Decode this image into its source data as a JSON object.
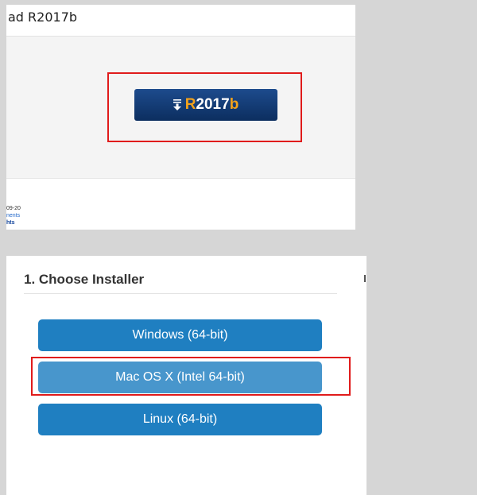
{
  "download_page": {
    "title": "ad R2017b",
    "download_button": {
      "icon": "download-arrow-icon",
      "release_prefix": "R",
      "release_year": "2017",
      "release_suffix": "b"
    },
    "footer": {
      "line1": "09-20",
      "line2": "nents",
      "line3": "hts"
    }
  },
  "installer": {
    "heading": "1. Choose Installer",
    "buttons": [
      {
        "label": "Windows (64-bit)"
      },
      {
        "label": "Mac OS X (Intel 64-bit)",
        "selected": true
      },
      {
        "label": "Linux (64-bit)"
      }
    ]
  },
  "colors": {
    "highlight_box": "#e01b1b",
    "download_button": "#0c2e5f",
    "release_accent": "#f3a21b",
    "installer_button": "#1f7fc1",
    "installer_button_selected": "#4896cc"
  }
}
